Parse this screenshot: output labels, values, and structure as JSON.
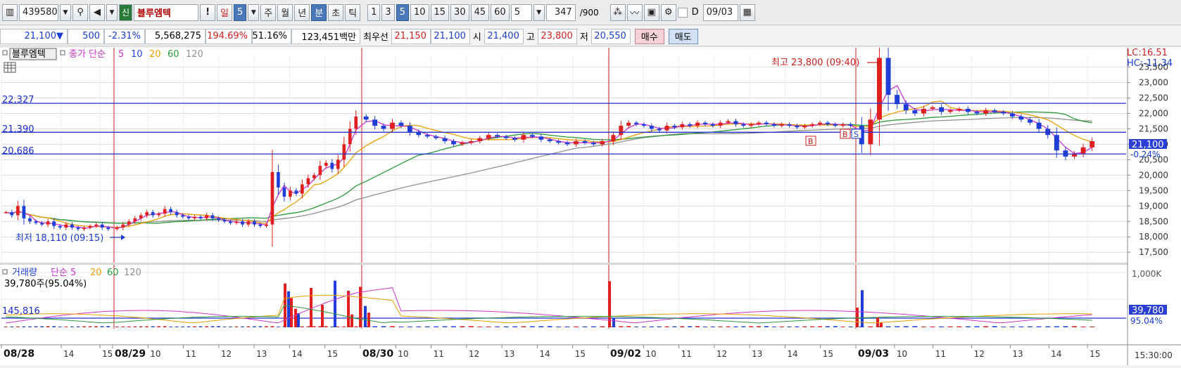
{
  "toolbar": {
    "code": "439580",
    "sin_label": "신",
    "stock_name": "블루엠텍",
    "excl": "!",
    "period_buttons": [
      "일",
      "5",
      "주",
      "월",
      "년",
      "분",
      "초",
      "틱"
    ],
    "minute_buttons": [
      "1",
      "3",
      "5",
      "10",
      "15",
      "30",
      "45",
      "60"
    ],
    "count_value": "5",
    "page_count": "347",
    "page_total": "/900",
    "d_label": "D",
    "date_value": "09/03"
  },
  "quote": {
    "price": "21,100",
    "change_arrow": "▼",
    "change": "500",
    "change_pct": "-2.31%",
    "volume": "5,568,275",
    "vol_ratio": "194.69%",
    "turnover_ratio": "51.16%",
    "amount": "123,451백만",
    "best_label": "최우선",
    "best_ask": "21,150",
    "best_bid": "21,100",
    "open_label": "시",
    "open": "21,400",
    "high_label": "고",
    "high": "23,800",
    "low_label": "저",
    "low": "20,550",
    "buy_label": "매수",
    "sell_label": "매도"
  },
  "colors": {
    "up": "#e02020",
    "down": "#1f3fd8",
    "ma5": "#cc33cc",
    "ma10": "#2244dd",
    "ma20": "#e8a000",
    "ma60": "#2a9a3a",
    "ma120": "#909090",
    "hline": "#2233cc",
    "vline": "#d02020"
  },
  "chart_data": [
    {
      "type": "candlestick",
      "title": "블루엠텍",
      "legend": [
        "종가 단순",
        "5",
        "10",
        "20",
        "60",
        "120"
      ],
      "x_tick_labels": [
        "08/28",
        "14",
        "15",
        "08/29",
        "10",
        "11",
        "12",
        "13",
        "14",
        "15",
        "08/30",
        "10",
        "11",
        "12",
        "13",
        "14",
        "15",
        "09/02",
        "10",
        "11",
        "12",
        "13",
        "14",
        "15",
        "09/03",
        "10",
        "11",
        "12",
        "13",
        "14",
        "15"
      ],
      "y_ticks": [
        17500,
        18000,
        18500,
        19000,
        19500,
        20000,
        20500,
        21000,
        21500,
        22000,
        22500,
        23000,
        23500
      ],
      "ylim": [
        17300,
        23900
      ],
      "hlines": [
        {
          "label": "22,327",
          "value": 22327
        },
        {
          "label": "21,390",
          "value": 21390
        },
        {
          "label": "20,686",
          "value": 20686
        }
      ],
      "annotations": [
        {
          "text": "최고 23,800 (09:40)",
          "value": 23800
        },
        {
          "text": "최저 18,110 (09:15)",
          "value": 18110
        }
      ],
      "markers": [
        "B",
        "B",
        "S"
      ],
      "price_label": "21,100",
      "price_change_label": "-0.24%",
      "lc_label": "LC:16.51",
      "hc_label": "HC:-11.34",
      "segments": [
        {
          "session": "08/28",
          "points": [
            18800,
            18700,
            19000,
            18600,
            18500,
            18450,
            18400,
            18500,
            18350,
            18300,
            18400,
            18300,
            18250,
            18300,
            18350,
            18400,
            18300,
            18250
          ]
        },
        {
          "session": "08/29",
          "points": [
            18300,
            18400,
            18500,
            18600,
            18700,
            18800,
            18700,
            18750,
            18900,
            18800,
            18700,
            18650,
            18600,
            18650,
            18600,
            18700,
            18600,
            18550,
            18500,
            18450,
            18500,
            18400,
            18500,
            18400,
            18350,
            18400,
            20100,
            19600,
            19300,
            19500,
            19400,
            19700,
            19900,
            20000,
            20300,
            20400,
            20200,
            20500,
            21000,
            21500,
            21900
          ]
        },
        {
          "session": "08/30",
          "points": [
            21800,
            21600,
            21500,
            21700,
            21600,
            21400,
            21300,
            21250,
            21200,
            21100,
            21000,
            21050,
            21100,
            21200,
            21300,
            21250,
            21200,
            21150,
            21300,
            21250,
            21150,
            21100,
            21050,
            21000,
            21100,
            21050,
            21000,
            21100
          ]
        },
        {
          "session": "09/02",
          "points": [
            21300,
            21600,
            21700,
            21650,
            21600,
            21500,
            21450,
            21600,
            21550,
            21650,
            21600,
            21700,
            21650,
            21600,
            21700,
            21750,
            21650,
            21600,
            21650,
            21700,
            21650,
            21600,
            21650,
            21600,
            21550,
            21600,
            21650,
            21700,
            21650,
            21600,
            21650,
            21600
          ]
        },
        {
          "session": "09/03",
          "points": [
            21000,
            21800,
            23800,
            22600,
            22300,
            22100,
            22000,
            22150,
            22200,
            22050,
            22100,
            22150,
            22050,
            22000,
            22100,
            22050,
            22000,
            21900,
            21800,
            21700,
            21500,
            21300,
            20800,
            20600,
            20700,
            20900,
            21100
          ]
        }
      ]
    },
    {
      "type": "bar",
      "title": "거래량",
      "legend": [
        "단순 5",
        "20",
        "60",
        "120"
      ],
      "last_label": "39,780주(95.04%)",
      "hline_label": "145,816",
      "y_ticks_label": "1,000K",
      "right_value_label": "39,780",
      "right_pct_label": "95.04%",
      "time_label": "15:30:00",
      "spikes": [
        {
          "session": "08/29",
          "values": [
            780,
            640,
            520,
            330,
            250,
            700,
            400,
            830,
            650,
            230
          ]
        },
        {
          "session": "08/30",
          "values": [
            720,
            380,
            260
          ]
        },
        {
          "session": "09/02",
          "values": [
            820,
            160
          ]
        },
        {
          "session": "09/03",
          "values": [
            350,
            660,
            170,
            80
          ]
        }
      ]
    }
  ]
}
